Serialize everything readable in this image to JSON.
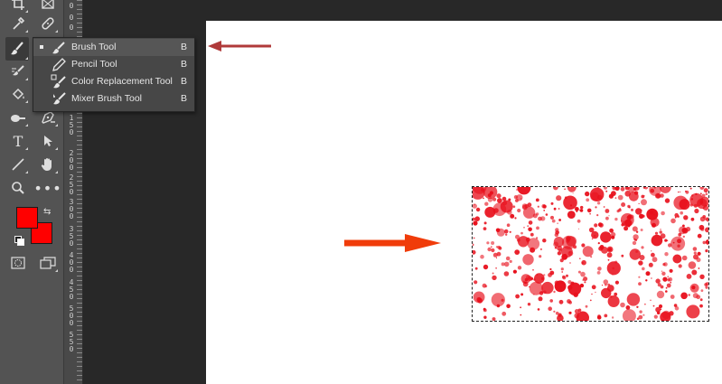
{
  "ruler": {
    "numbers": [
      "0",
      "0",
      "0",
      "1\n5\n0",
      "2\n0\n0",
      "2\n5\n0",
      "3\n0\n0",
      "3\n5\n0",
      "4\n0\n0",
      "4\n5\n0",
      "5\n0\n0",
      "5\n5\n0"
    ]
  },
  "tools": [
    {
      "name": "crop-tool",
      "icon": "crop-icon"
    },
    {
      "name": "frame-tool",
      "icon": "frame-icon"
    },
    {
      "name": "eyedropper-tool",
      "icon": "eyedropper-icon"
    },
    {
      "name": "healing-brush-tool",
      "icon": "bandage-icon"
    },
    {
      "name": "brush-tool",
      "icon": "brush-icon",
      "active": true
    },
    {
      "name": "clone-stamp-tool",
      "icon": "stamp-icon"
    },
    {
      "name": "paint-bucket-tool",
      "icon": "bucket-icon"
    },
    {
      "name": "blur-tool",
      "icon": "drop-icon"
    },
    {
      "name": "dodge-tool",
      "icon": "dodge-icon"
    },
    {
      "name": "pen-tool",
      "icon": "pen-icon"
    },
    {
      "name": "type-tool",
      "icon": "type-icon",
      "glyph": "T"
    },
    {
      "name": "path-selection-tool",
      "icon": "arrow-icon"
    },
    {
      "name": "line-tool",
      "icon": "line-icon"
    },
    {
      "name": "hand-tool",
      "icon": "hand-icon"
    },
    {
      "name": "zoom-tool",
      "icon": "zoom-icon"
    },
    {
      "name": "more-tools",
      "icon": "ellipsis-icon",
      "glyph": "•••"
    },
    {
      "name": "quick-mask-button",
      "icon": "quick-mask-icon"
    },
    {
      "name": "screen-mode-button",
      "icon": "screen-mode-icon"
    }
  ],
  "colors": {
    "foreground": "#ff0000",
    "background": "#ff0000",
    "accent_arrow": "#f03c0a",
    "pointer_arrow": "#b03a3a",
    "splatter": "#e8101c"
  },
  "flyout": {
    "items": [
      {
        "label": "Brush Tool",
        "shortcut": "B",
        "icon": "brush-icon",
        "selected": true
      },
      {
        "label": "Pencil Tool",
        "shortcut": "B",
        "icon": "pencil-icon"
      },
      {
        "label": "Color Replacement Tool",
        "shortcut": "B",
        "icon": "color-replacement-icon"
      },
      {
        "label": "Mixer Brush Tool",
        "shortcut": "B",
        "icon": "mixer-brush-icon"
      }
    ]
  }
}
